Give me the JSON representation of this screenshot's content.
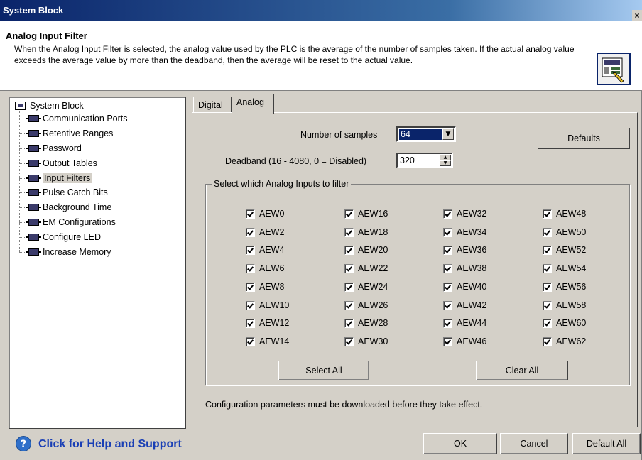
{
  "window": {
    "title": "System Block",
    "close_glyph": "×"
  },
  "header": {
    "title": "Analog Input Filter",
    "description": "When the Analog Input Filter is selected, the analog value used by the PLC is the average of the number of samples taken.  If the actual analog value exceeds the average value by more than the deadband, then the average will be reset to the actual value.",
    "icon": "input-filter-icon"
  },
  "tree": {
    "root": "System Block",
    "items": [
      {
        "label": "Communication Ports"
      },
      {
        "label": "Retentive Ranges"
      },
      {
        "label": "Password"
      },
      {
        "label": "Output Tables"
      },
      {
        "label": "Input Filters",
        "selected": true
      },
      {
        "label": "Pulse Catch Bits"
      },
      {
        "label": "Background Time"
      },
      {
        "label": "EM Configurations"
      },
      {
        "label": "Configure LED"
      },
      {
        "label": "Increase Memory"
      }
    ]
  },
  "tabs": [
    {
      "label": "Digital",
      "active": false
    },
    {
      "label": "Analog",
      "active": true
    }
  ],
  "analog": {
    "samples_label": "Number of samples",
    "samples_value": "64",
    "deadband_label": "Deadband (16 - 4080, 0 = Disabled)",
    "deadband_value": "320",
    "defaults_button": "Defaults",
    "group_label": "Select which Analog Inputs to filter",
    "columns": [
      [
        "AEW0",
        "AEW2",
        "AEW4",
        "AEW6",
        "AEW8",
        "AEW10",
        "AEW12",
        "AEW14"
      ],
      [
        "AEW16",
        "AEW18",
        "AEW20",
        "AEW22",
        "AEW24",
        "AEW26",
        "AEW28",
        "AEW30"
      ],
      [
        "AEW32",
        "AEW34",
        "AEW36",
        "AEW38",
        "AEW40",
        "AEW42",
        "AEW44",
        "AEW46"
      ],
      [
        "AEW48",
        "AEW50",
        "AEW52",
        "AEW54",
        "AEW56",
        "AEW58",
        "AEW60",
        "AEW62"
      ]
    ],
    "all_checked": true,
    "select_all_button": "Select All",
    "clear_all_button": "Clear All",
    "note": "Configuration parameters must be downloaded before they take effect."
  },
  "footer": {
    "help_text": "Click for Help and Support",
    "ok_button": "OK",
    "cancel_button": "Cancel",
    "default_all_button": "Default All"
  },
  "colors": {
    "title_bar": "#0a246a",
    "dialog_bg": "#d4d0c8",
    "help_link": "#1a3fb5"
  }
}
